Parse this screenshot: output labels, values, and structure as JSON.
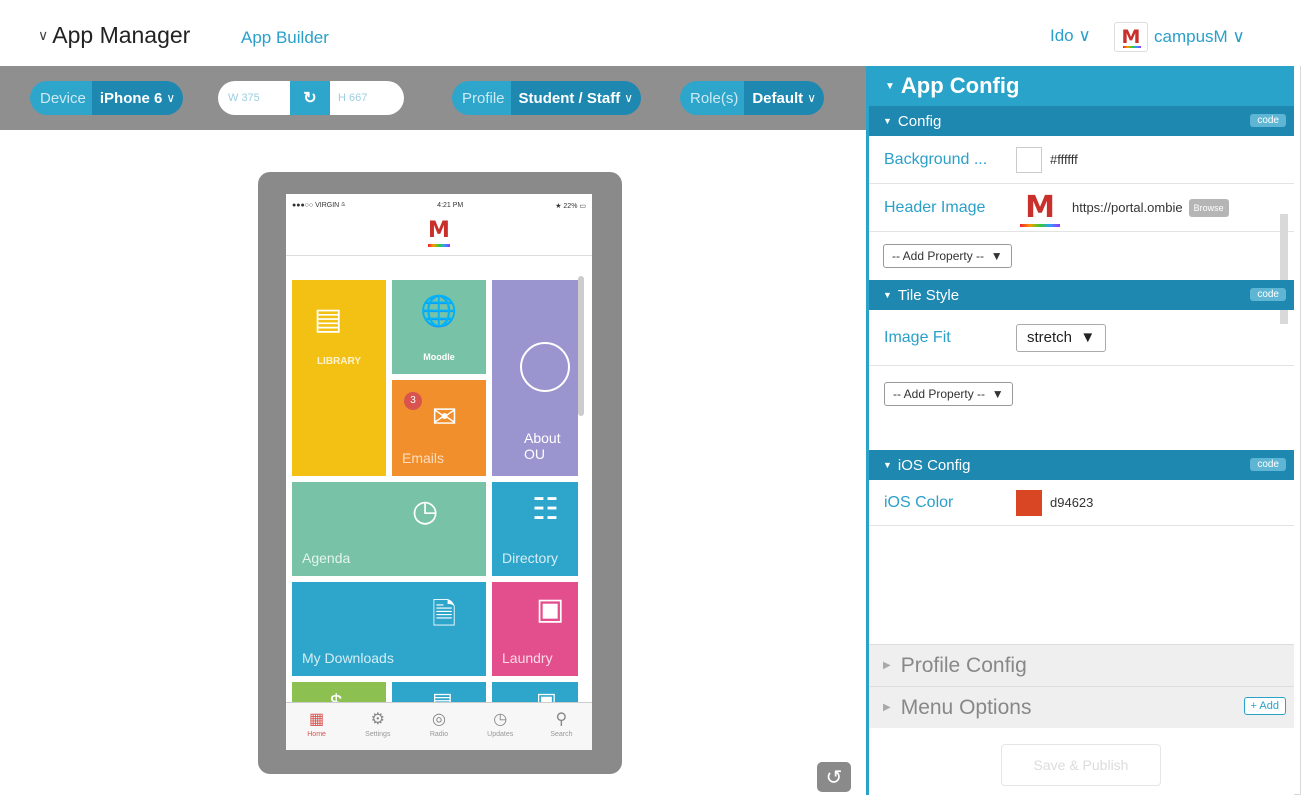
{
  "header": {
    "title": "App Manager",
    "subtitle": "App Builder",
    "user": "Ido ∨",
    "org_logo": "M",
    "org": "campusM ∨"
  },
  "toolbar": {
    "device_label": "Device",
    "device_value": "iPhone 6",
    "width_label": "W 375",
    "height_label": "H 667",
    "profile_label": "Profile",
    "profile_value": "Student / Staff",
    "role_label": "Role(s)",
    "role_value": "Default"
  },
  "phone": {
    "carrier": "●●●○○ VIRGIN ⩯",
    "time": "4:21 PM",
    "battery": "★ 22% ▭",
    "logo": "M",
    "tiles": {
      "library": "LIBRARY",
      "moodle": "Moodle",
      "emails": "Emails",
      "emails_badge": "3",
      "about": "About OU",
      "agenda": "Agenda",
      "directory": "Directory",
      "downloads": "My Downloads",
      "laundry": "Laundry"
    },
    "tabs": [
      "Home",
      "Settings",
      "Radio",
      "Updates",
      "Search"
    ]
  },
  "config": {
    "panel_title": "App Config",
    "config_section": "Config",
    "code_label": "code",
    "background_label": "Background ...",
    "background_value": "#ffffff",
    "header_image_label": "Header Image",
    "header_image_value": "https://portal.ombie",
    "browse_label": "Browse",
    "add_property": "-- Add Property --",
    "tile_section": "Tile Style",
    "image_fit_label": "Image Fit",
    "image_fit_value": "stretch",
    "ios_section": "iOS Config",
    "ios_color_label": "iOS Color",
    "ios_color_value": "d94623",
    "profile_config": "Profile Config",
    "menu_options": "Menu Options",
    "add_label": "+ Add",
    "save_label": "Save & Publish"
  },
  "colors": {
    "accent": "#29a3c9",
    "ios_color": "#d94623"
  }
}
